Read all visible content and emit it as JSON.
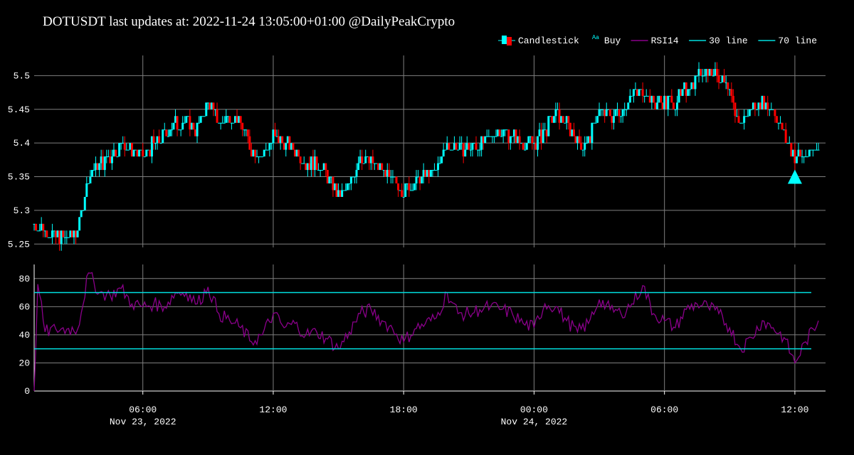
{
  "title": "DOTUSDT last updates at: 2022-11-24 13:05:00+01:00 @DailyPeakCrypto",
  "colors": {
    "background": "#000000",
    "grid": "#7f7f7f",
    "up": "#00ffff",
    "down": "#ff0000",
    "rsi": "#8b008b",
    "line30": "#00e0e0",
    "line70": "#00e0e0",
    "buy": "#00ffff"
  },
  "legend": [
    {
      "label": "Candlestick",
      "kind": "candle"
    },
    {
      "label": "Buy",
      "kind": "text-marker",
      "marker": "Aa"
    },
    {
      "label": "RSI14",
      "kind": "line",
      "color": "#8b008b"
    },
    {
      "label": "30 line",
      "kind": "line",
      "color": "#00e0e0"
    },
    {
      "label": "70 line",
      "kind": "line",
      "color": "#00e0e0"
    }
  ],
  "chart_data": [
    {
      "type": "candlestick",
      "x_range": [
        "2022-11-23 01:00",
        "2022-11-24 13:05"
      ],
      "x_ticks": [
        {
          "value": "2022-11-23 06:00",
          "label": "06:00",
          "sublabel": "Nov 23, 2022"
        },
        {
          "value": "2022-11-23 12:00",
          "label": "12:00"
        },
        {
          "value": "2022-11-23 18:00",
          "label": "18:00"
        },
        {
          "value": "2022-11-24 00:00",
          "label": "00:00",
          "sublabel": "Nov 24, 2022"
        },
        {
          "value": "2022-11-24 06:00",
          "label": "06:00"
        },
        {
          "value": "2022-11-24 12:00",
          "label": "12:00"
        }
      ],
      "ylim": [
        5.245,
        5.53
      ],
      "y_ticks": [
        5.25,
        5.3,
        5.35,
        5.4,
        5.45,
        5.5
      ],
      "grid": true,
      "close_series": [
        [
          "2022-11-23 01:00",
          5.28
        ],
        [
          "2022-11-23 01:30",
          5.27
        ],
        [
          "2022-11-23 02:00",
          5.26
        ],
        [
          "2022-11-23 02:30",
          5.26
        ],
        [
          "2022-11-23 03:00",
          5.27
        ],
        [
          "2022-11-23 03:30",
          5.35
        ],
        [
          "2022-11-23 04:00",
          5.37
        ],
        [
          "2022-11-23 04:30",
          5.38
        ],
        [
          "2022-11-23 05:00",
          5.4
        ],
        [
          "2022-11-23 05:30",
          5.39
        ],
        [
          "2022-11-23 06:00",
          5.38
        ],
        [
          "2022-11-23 06:30",
          5.4
        ],
        [
          "2022-11-23 07:00",
          5.41
        ],
        [
          "2022-11-23 07:30",
          5.43
        ],
        [
          "2022-11-23 08:00",
          5.43
        ],
        [
          "2022-11-23 08:30",
          5.42
        ],
        [
          "2022-11-23 09:00",
          5.46
        ],
        [
          "2022-11-23 09:30",
          5.43
        ],
        [
          "2022-11-23 10:00",
          5.44
        ],
        [
          "2022-11-23 10:30",
          5.43
        ],
        [
          "2022-11-23 11:00",
          5.39
        ],
        [
          "2022-11-23 11:30",
          5.38
        ],
        [
          "2022-11-23 12:00",
          5.41
        ],
        [
          "2022-11-23 12:30",
          5.4
        ],
        [
          "2022-11-23 13:00",
          5.39
        ],
        [
          "2022-11-23 13:30",
          5.37
        ],
        [
          "2022-11-23 14:00",
          5.37
        ],
        [
          "2022-11-23 14:30",
          5.35
        ],
        [
          "2022-11-23 15:00",
          5.32
        ],
        [
          "2022-11-23 15:30",
          5.34
        ],
        [
          "2022-11-23 16:00",
          5.38
        ],
        [
          "2022-11-23 16:30",
          5.37
        ],
        [
          "2022-11-23 17:00",
          5.36
        ],
        [
          "2022-11-23 17:30",
          5.34
        ],
        [
          "2022-11-23 18:00",
          5.33
        ],
        [
          "2022-11-23 18:30",
          5.34
        ],
        [
          "2022-11-23 19:00",
          5.35
        ],
        [
          "2022-11-23 19:30",
          5.36
        ],
        [
          "2022-11-23 20:00",
          5.4
        ],
        [
          "2022-11-23 20:30",
          5.39
        ],
        [
          "2022-11-23 21:00",
          5.39
        ],
        [
          "2022-11-23 21:30",
          5.4
        ],
        [
          "2022-11-23 22:00",
          5.41
        ],
        [
          "2022-11-23 22:30",
          5.42
        ],
        [
          "2022-11-23 23:00",
          5.41
        ],
        [
          "2022-11-23 23:30",
          5.4
        ],
        [
          "2022-11-24 00:00",
          5.4
        ],
        [
          "2022-11-24 00:30",
          5.42
        ],
        [
          "2022-11-24 01:00",
          5.44
        ],
        [
          "2022-11-24 01:30",
          5.43
        ],
        [
          "2022-11-24 02:00",
          5.4
        ],
        [
          "2022-11-24 02:30",
          5.4
        ],
        [
          "2022-11-24 03:00",
          5.45
        ],
        [
          "2022-11-24 03:30",
          5.44
        ],
        [
          "2022-11-24 04:00",
          5.45
        ],
        [
          "2022-11-24 04:30",
          5.47
        ],
        [
          "2022-11-24 05:00",
          5.48
        ],
        [
          "2022-11-24 05:30",
          5.46
        ],
        [
          "2022-11-24 06:00",
          5.46
        ],
        [
          "2022-11-24 06:30",
          5.46
        ],
        [
          "2022-11-24 07:00",
          5.48
        ],
        [
          "2022-11-24 07:30",
          5.5
        ],
        [
          "2022-11-24 08:00",
          5.51
        ],
        [
          "2022-11-24 08:30",
          5.5
        ],
        [
          "2022-11-24 09:00",
          5.47
        ],
        [
          "2022-11-24 09:30",
          5.43
        ],
        [
          "2022-11-24 10:00",
          5.45
        ],
        [
          "2022-11-24 10:30",
          5.46
        ],
        [
          "2022-11-24 11:00",
          5.45
        ],
        [
          "2022-11-24 11:30",
          5.41
        ],
        [
          "2022-11-24 12:00",
          5.38
        ],
        [
          "2022-11-24 12:30",
          5.38
        ],
        [
          "2022-11-24 13:05",
          5.39
        ]
      ],
      "buy_signals": [
        {
          "x": "2022-11-24 12:00",
          "y": 5.35
        }
      ]
    },
    {
      "type": "line",
      "ylim": [
        0,
        90
      ],
      "y_ticks": [
        0,
        20,
        40,
        60,
        80
      ],
      "grid": true,
      "series": [
        {
          "name": "RSI14",
          "points": [
            [
              "2022-11-23 01:00",
              0
            ],
            [
              "2022-11-23 01:10",
              76
            ],
            [
              "2022-11-23 01:30",
              42
            ],
            [
              "2022-11-23 02:00",
              44
            ],
            [
              "2022-11-23 02:30",
              44
            ],
            [
              "2022-11-23 03:00",
              44
            ],
            [
              "2022-11-23 03:30",
              84
            ],
            [
              "2022-11-23 04:00",
              70
            ],
            [
              "2022-11-23 04:30",
              68
            ],
            [
              "2022-11-23 05:00",
              73
            ],
            [
              "2022-11-23 05:30",
              62
            ],
            [
              "2022-11-23 06:00",
              60
            ],
            [
              "2022-11-23 06:30",
              62
            ],
            [
              "2022-11-23 07:00",
              60
            ],
            [
              "2022-11-23 07:30",
              70
            ],
            [
              "2022-11-23 08:00",
              70
            ],
            [
              "2022-11-23 08:30",
              62
            ],
            [
              "2022-11-23 09:00",
              74
            ],
            [
              "2022-11-23 09:30",
              55
            ],
            [
              "2022-11-23 10:00",
              50
            ],
            [
              "2022-11-23 10:30",
              45
            ],
            [
              "2022-11-23 11:00",
              35
            ],
            [
              "2022-11-23 11:30",
              40
            ],
            [
              "2022-11-23 12:00",
              55
            ],
            [
              "2022-11-23 12:30",
              45
            ],
            [
              "2022-11-23 13:00",
              48
            ],
            [
              "2022-11-23 13:30",
              40
            ],
            [
              "2022-11-23 14:00",
              42
            ],
            [
              "2022-11-23 14:30",
              37
            ],
            [
              "2022-11-23 15:00",
              30
            ],
            [
              "2022-11-23 15:30",
              42
            ],
            [
              "2022-11-23 16:00",
              55
            ],
            [
              "2022-11-23 16:30",
              58
            ],
            [
              "2022-11-23 17:00",
              50
            ],
            [
              "2022-11-23 17:30",
              44
            ],
            [
              "2022-11-23 18:00",
              35
            ],
            [
              "2022-11-23 18:30",
              44
            ],
            [
              "2022-11-23 19:00",
              48
            ],
            [
              "2022-11-23 19:30",
              52
            ],
            [
              "2022-11-23 20:00",
              70
            ],
            [
              "2022-11-23 20:30",
              55
            ],
            [
              "2022-11-23 21:00",
              55
            ],
            [
              "2022-11-23 21:30",
              58
            ],
            [
              "2022-11-23 22:00",
              60
            ],
            [
              "2022-11-23 22:30",
              58
            ],
            [
              "2022-11-23 23:00",
              55
            ],
            [
              "2022-11-23 23:30",
              48
            ],
            [
              "2022-11-24 00:00",
              45
            ],
            [
              "2022-11-24 00:30",
              62
            ],
            [
              "2022-11-24 01:00",
              60
            ],
            [
              "2022-11-24 01:30",
              50
            ],
            [
              "2022-11-24 02:00",
              42
            ],
            [
              "2022-11-24 02:30",
              48
            ],
            [
              "2022-11-24 03:00",
              65
            ],
            [
              "2022-11-24 03:30",
              58
            ],
            [
              "2022-11-24 04:00",
              55
            ],
            [
              "2022-11-24 04:30",
              62
            ],
            [
              "2022-11-24 05:00",
              75
            ],
            [
              "2022-11-24 05:30",
              55
            ],
            [
              "2022-11-24 06:00",
              50
            ],
            [
              "2022-11-24 06:30",
              45
            ],
            [
              "2022-11-24 07:00",
              58
            ],
            [
              "2022-11-24 07:30",
              62
            ],
            [
              "2022-11-24 08:00",
              60
            ],
            [
              "2022-11-24 08:30",
              55
            ],
            [
              "2022-11-24 09:00",
              45
            ],
            [
              "2022-11-24 09:30",
              30
            ],
            [
              "2022-11-24 10:00",
              38
            ],
            [
              "2022-11-24 10:30",
              50
            ],
            [
              "2022-11-24 11:00",
              45
            ],
            [
              "2022-11-24 11:30",
              38
            ],
            [
              "2022-11-24 12:00",
              20
            ],
            [
              "2022-11-24 12:30",
              35
            ],
            [
              "2022-11-24 13:05",
              50
            ]
          ]
        },
        {
          "name": "30 line",
          "y": 30
        },
        {
          "name": "70 line",
          "y": 70
        }
      ]
    }
  ]
}
